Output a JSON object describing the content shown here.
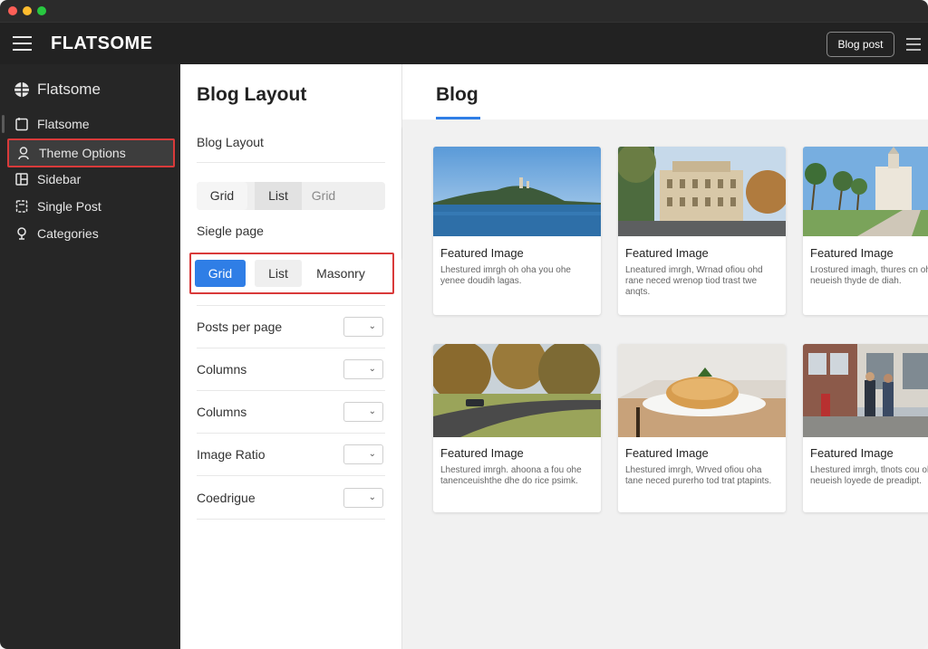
{
  "app": {
    "brand": "FLATSOME",
    "header_button": "Blog post"
  },
  "sidebar": {
    "head": "Flatsome",
    "items": [
      {
        "label": "Flatsome",
        "icon": "page-icon"
      },
      {
        "label": "Theme Options",
        "icon": "user-icon",
        "active": true
      },
      {
        "label": "Sidebar",
        "icon": "layout-icon"
      },
      {
        "label": "Single Post",
        "icon": "document-icon"
      },
      {
        "label": "Categories",
        "icon": "tag-icon"
      }
    ]
  },
  "settings": {
    "title": "Blog Layout",
    "section_label": "Blog Layout",
    "layout_options": [
      "Grid",
      "List",
      "Grid"
    ],
    "single_label": "Siegle page",
    "single_options": [
      "Grid",
      "List",
      "Masonry"
    ],
    "rows": [
      {
        "label": "Posts per page"
      },
      {
        "label": "Columns"
      },
      {
        "label": "Columns"
      },
      {
        "label": "Image Ratio"
      },
      {
        "label": "Coedrigue"
      }
    ]
  },
  "content": {
    "title": "Blog",
    "cards": [
      {
        "title": "Featured Image",
        "desc": "Lhestured imrgh oh oha you ohe yenee doudih lagas."
      },
      {
        "title": "Featured Image",
        "desc": "Lneatured imrgh, Wrnad ofiou ohd rane neced wrenop tiod trast twe anqts."
      },
      {
        "title": "Featured Image",
        "desc": "Lrostured imagh, thures cn ohe tane neueish thyde de diah."
      },
      {
        "title": "Featured Image",
        "desc": "Lhestured imrgh. ahoona a fou ohe tanenceuishthe dhe do rice psimk."
      },
      {
        "title": "Featured Image",
        "desc": "Lhestured imrgh, Wrved ofiou oha tane neced purerho tod trat ptapints."
      },
      {
        "title": "Featured Image",
        "desc": "Lhestured imrgh, tlnots cou ohd tane neueish loyede de preadipt."
      }
    ]
  },
  "colors": {
    "accent": "#2f7ee6",
    "highlight": "#d93a3a",
    "topbar": "#222222",
    "sidebar": "#262626"
  }
}
